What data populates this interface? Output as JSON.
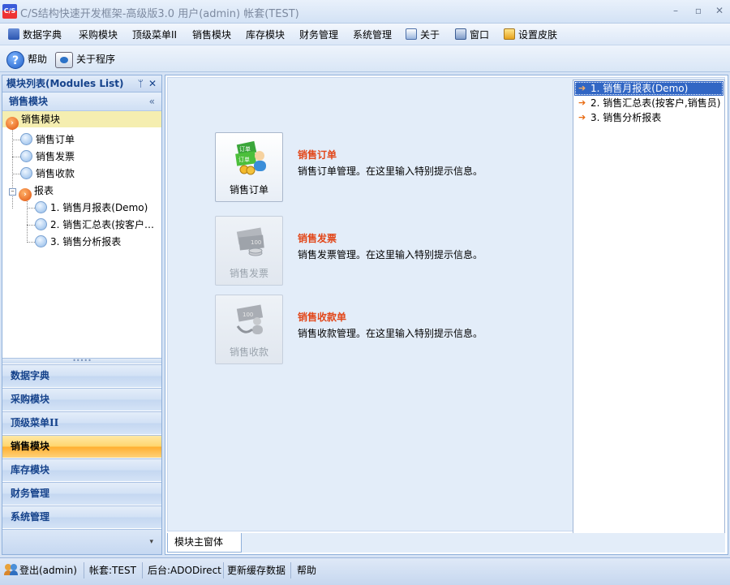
{
  "window": {
    "title": "C/S结构快速开发框架-高级版3.0 用户(admin) 帐套(TEST)",
    "app_icon_text": "C/S",
    "minimize": "–",
    "maximize": "▫",
    "close": "✕"
  },
  "menu": [
    {
      "label": "数据字典",
      "icon": "book-icon"
    },
    {
      "label": "采购模块"
    },
    {
      "label": "顶级菜单II"
    },
    {
      "label": "销售模块"
    },
    {
      "label": "库存模块"
    },
    {
      "label": "财务管理"
    },
    {
      "label": "系统管理"
    },
    {
      "label": "关于",
      "icon": "about-window-icon"
    },
    {
      "label": "窗口",
      "icon": "window-icon"
    },
    {
      "label": "设置皮肤",
      "icon": "skin-icon"
    }
  ],
  "toolbar": {
    "help_label": "帮助",
    "help_icon_text": "?",
    "about_label": "关于程序"
  },
  "left_panel": {
    "title": "模块列表(Modules List)",
    "pin_icon": "ᛘ",
    "close_icon": "✕",
    "group_title": "销售模块",
    "collapse_icon": "«",
    "tree": {
      "root": "销售模块",
      "items": [
        "销售订单",
        "销售发票",
        "销售收款"
      ],
      "reports_folder": "报表",
      "reports": [
        "1. 销售月报表(Demo)",
        "2. 销售汇总表(按客户…",
        "3. 销售分析报表"
      ]
    },
    "splitter_grip": "•••••",
    "nav_buttons": [
      "数据字典",
      "采购模块",
      "顶级菜单II",
      "销售模块",
      "库存模块",
      "财务管理",
      "系统管理"
    ],
    "active_nav": "销售模块",
    "more_icon": "▾"
  },
  "modules": [
    {
      "tile_label": "销售订单",
      "title": "销售订单",
      "desc": "销售订单管理。在这里输入特别提示信息。",
      "enabled": true
    },
    {
      "tile_label": "销售发票",
      "title": "销售发票",
      "desc": "销售发票管理。在这里输入特别提示信息。",
      "enabled": false
    },
    {
      "tile_label": "销售收款",
      "title": "销售收款单",
      "desc": "销售收款管理。在这里输入特别提示信息。",
      "enabled": false
    }
  ],
  "reports_list": {
    "items": [
      "1. 销售月报表(Demo)",
      "2. 销售汇总表(按客户,销售员)",
      "3. 销售分析报表"
    ],
    "selected": "1. 销售月报表(Demo)",
    "arrow": "➔"
  },
  "tabs": [
    {
      "label": "模块主窗体"
    }
  ],
  "status": {
    "logout": "登出(admin)",
    "account": "帐套:TEST",
    "backend": "后台:ADODirect",
    "refresh_cache": "更新缓存数据",
    "help": "帮助"
  }
}
